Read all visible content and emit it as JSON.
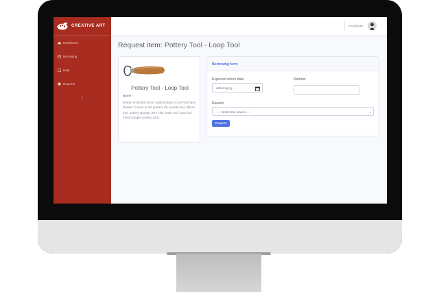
{
  "app": {
    "brand_name": "CREATIVE ART",
    "colors": {
      "sidebar": "#a82c1f",
      "primary": "#4e73df",
      "text": "#5a5c69",
      "muted": "#858796"
    }
  },
  "sidebar": {
    "items": [
      {
        "label": "Dashboard",
        "icon": "dashboard-icon"
      },
      {
        "label": "Borrowing",
        "icon": "calendar-icon"
      },
      {
        "label": "Help",
        "icon": "help-icon"
      },
      {
        "label": "Request",
        "icon": "request-icon"
      }
    ],
    "toggle_icon": "‹"
  },
  "topbar": {
    "username": "zmonari19"
  },
  "page": {
    "title": "Request item: Pottery Tool - Loop Tool"
  },
  "item": {
    "name": "Pottery Tool - Loop Tool",
    "label": "Name",
    "description": "Brand: Art Board Store: addictedtoart.co.za Purchase Details: Comes in set (potters rib, needle tool, ribbon tool, pottery sponge, wire clay cutter tool, loop tool, metal scraper pottery tool)."
  },
  "form": {
    "header": "Borrowing form",
    "date_label": "Expected return date",
    "date_placeholder": "dd/mm/yyyy",
    "number_label": "Number",
    "number_value": "",
    "reason_label": "Reason",
    "reason_selected": "---- Select the reason----",
    "submit_label": "Request"
  }
}
